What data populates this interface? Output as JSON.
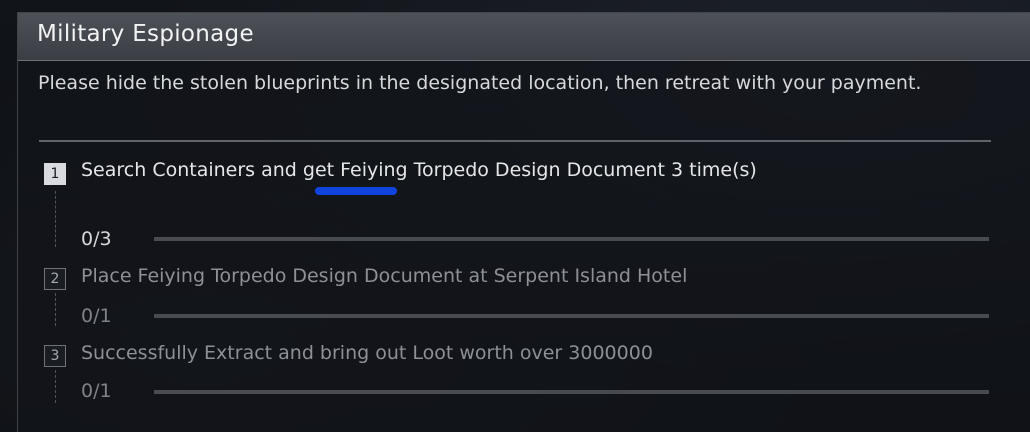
{
  "mission": {
    "title": "Military Espionage",
    "description": "Please hide the stolen blueprints in the designated location, then retreat with your payment."
  },
  "tasks": [
    {
      "number": "1",
      "text": "Search Containers and get Feiying Torpedo Design Document 3 time(s)",
      "progress": "0/3",
      "progress_fraction": 0,
      "state": "active"
    },
    {
      "number": "2",
      "text": "Place Feiying Torpedo Design Document at Serpent Island Hotel",
      "progress": "0/1",
      "progress_fraction": 0,
      "state": "inactive"
    },
    {
      "number": "3",
      "text": "Successfully Extract and bring out Loot worth over 3000000",
      "progress": "0/1",
      "progress_fraction": 0,
      "state": "inactive"
    }
  ],
  "colors": {
    "header_bg": "#45484e",
    "active_text": "#e4e6e8",
    "inactive_text": "#8d9096",
    "highlight_underline": "#1144dd"
  }
}
